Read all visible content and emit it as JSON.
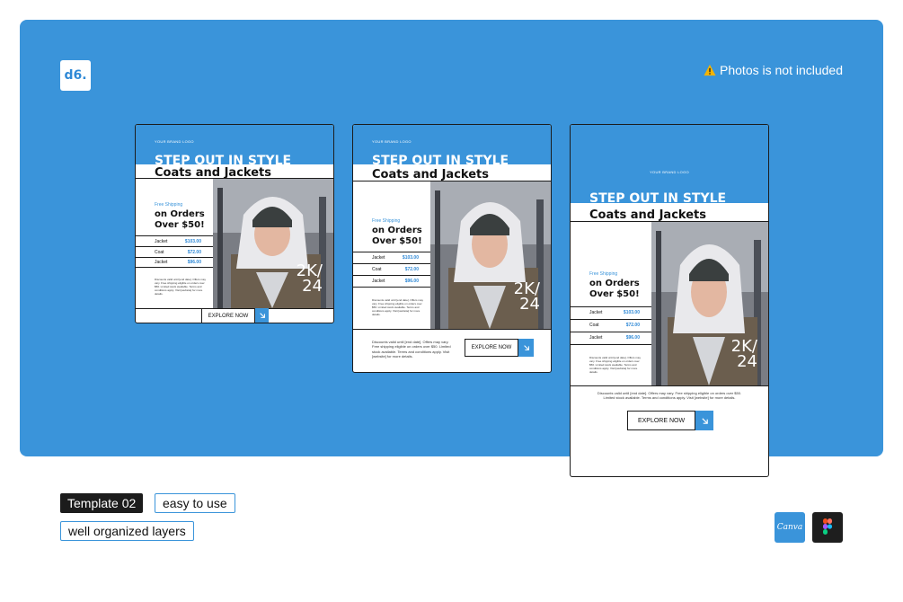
{
  "brand": {
    "logo_text": "d6."
  },
  "notice": {
    "text": "Photos is not included"
  },
  "template": {
    "brand_logo": "YOUR BRAND LOGO",
    "headline": "STEP OUT IN STYLE",
    "subheadline": "Coats and Jackets",
    "free_shipping": "Free Shipping",
    "offer": "on Orders Over $50!",
    "products": [
      {
        "name": "Jacket",
        "price": "$103.00"
      },
      {
        "name": "Coat",
        "price": "$72.00"
      },
      {
        "name": "Jacket",
        "price": "$96.00"
      }
    ],
    "badge": "2K/ 24",
    "disclaimer": "Discounts valid until [end date]. Offers may vary. Free shipping eligible on orders over $50. Limited stock available. Terms and conditions apply. Visit [website] for more details.",
    "cta": "EXPLORE NOW"
  },
  "tags": [
    "Template 02",
    "easy to use",
    "well organized layers"
  ],
  "apps": {
    "canva_label": "Canva"
  },
  "colors": {
    "accent": "#3a94da",
    "dark": "#1c1c1c"
  }
}
